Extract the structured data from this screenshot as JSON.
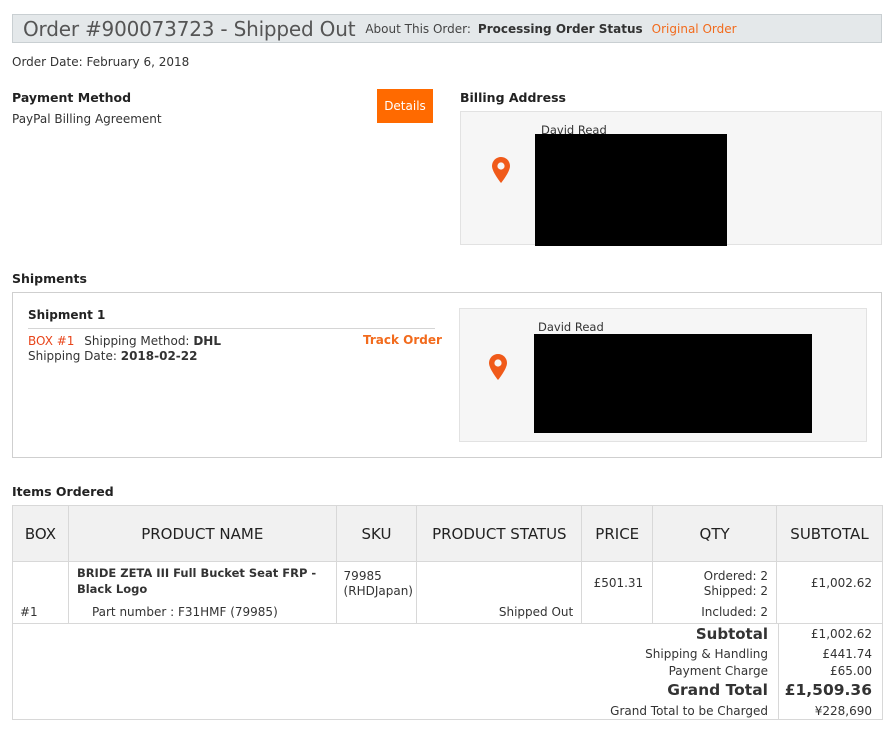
{
  "header": {
    "title": "Order #900073723 - Shipped Out",
    "about_label": "About This Order:",
    "processing_link": "Processing Order Status",
    "original_link": "Original Order"
  },
  "order_date": "Order Date: February 6, 2018",
  "payment": {
    "heading": "Payment Method",
    "value": "PayPal Billing Agreement",
    "details_button": "Details"
  },
  "billing": {
    "heading": "Billing Address",
    "name": "David Read",
    "pin_icon": "map-pin-icon"
  },
  "shipments": {
    "heading": "Shipments",
    "title": "Shipment 1",
    "box_label": "BOX #1",
    "method_label": "Shipping Method:",
    "method_value": "DHL",
    "date_label": "Shipping Date:",
    "date_value": "2018-02-22",
    "track_link": "Track Order",
    "address_name": "David Read"
  },
  "items": {
    "heading": "Items Ordered",
    "columns": [
      "BOX",
      "PRODUCT NAME",
      "SKU",
      "PRODUCT STATUS",
      "PRICE",
      "QTY",
      "SUBTOTAL"
    ],
    "rows": [
      {
        "box": "#1",
        "product_name": "BRIDE ZETA III Full Bucket Seat FRP - Black Logo",
        "part_number": "Part number : F31HMF (79985)",
        "sku": "79985",
        "sku_vendor": "(RHDJapan)",
        "status": "Shipped Out",
        "price": "£501.31",
        "ordered": "Ordered: 2",
        "shipped": "Shipped: 2",
        "included": "Included: 2",
        "subtotal": "£1,002.62"
      }
    ]
  },
  "totals": {
    "subtotal_label": "Subtotal",
    "subtotal_value": "£1,002.62",
    "shipping_label": "Shipping & Handling",
    "shipping_value": "£441.74",
    "payment_label": "Payment Charge",
    "payment_value": "£65.00",
    "grand_label": "Grand Total",
    "grand_value": "£1,509.36",
    "charged_label": "Grand Total to be Charged",
    "charged_value": "¥228,690"
  },
  "colors": {
    "accent": "#f26b1d",
    "button": "#ff6a00",
    "box_tag": "#e8451b",
    "header_bg": "#e4e8ea"
  }
}
